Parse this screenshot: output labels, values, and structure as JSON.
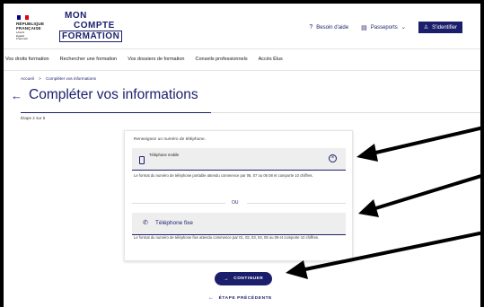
{
  "header": {
    "republic_line1": "RÉPUBLIQUE",
    "republic_line2": "FRANÇAISE",
    "motto_1": "Liberté",
    "motto_2": "Égalité",
    "motto_3": "Fraternité",
    "logo_1": "MON",
    "logo_2": "COMPTE",
    "logo_3": "FORMATION",
    "help": "Besoin d'aide",
    "passports": "Passeports",
    "login": "S'identifier"
  },
  "nav": {
    "items": [
      "Vos droits formation",
      "Rechercher une formation",
      "Vos dossiers de formation",
      "Conseils professionnels",
      "Accès Élus"
    ]
  },
  "breadcrumb": {
    "home": "Accueil",
    "sep": ">",
    "current": "Compléter vos informations"
  },
  "page": {
    "title": "Compléter vos informations",
    "step": "Étape 2 sur 5"
  },
  "form": {
    "instruction": "Renseignez un numéro de téléphone.",
    "mobile_label": "Téléphone mobile",
    "mobile_hint": "Le format du numéro de téléphone portable attendu commence par 06, 07 ou 06 08 et comporte 10 chiffres.",
    "or": "OU",
    "landline_label": "Téléphone fixe",
    "landline_hint": "Le format du numéro de téléphone fixe attendu commence par 01, 02, 03, 04, 05 ou 09 et comporte 10 chiffres."
  },
  "actions": {
    "continue": "CONTINUER",
    "previous": "ÉTAPE PRÉCÉDENTE"
  },
  "colors": {
    "primary": "#1b1f6b",
    "flag_blue": "#000091",
    "flag_red": "#e1000f"
  }
}
